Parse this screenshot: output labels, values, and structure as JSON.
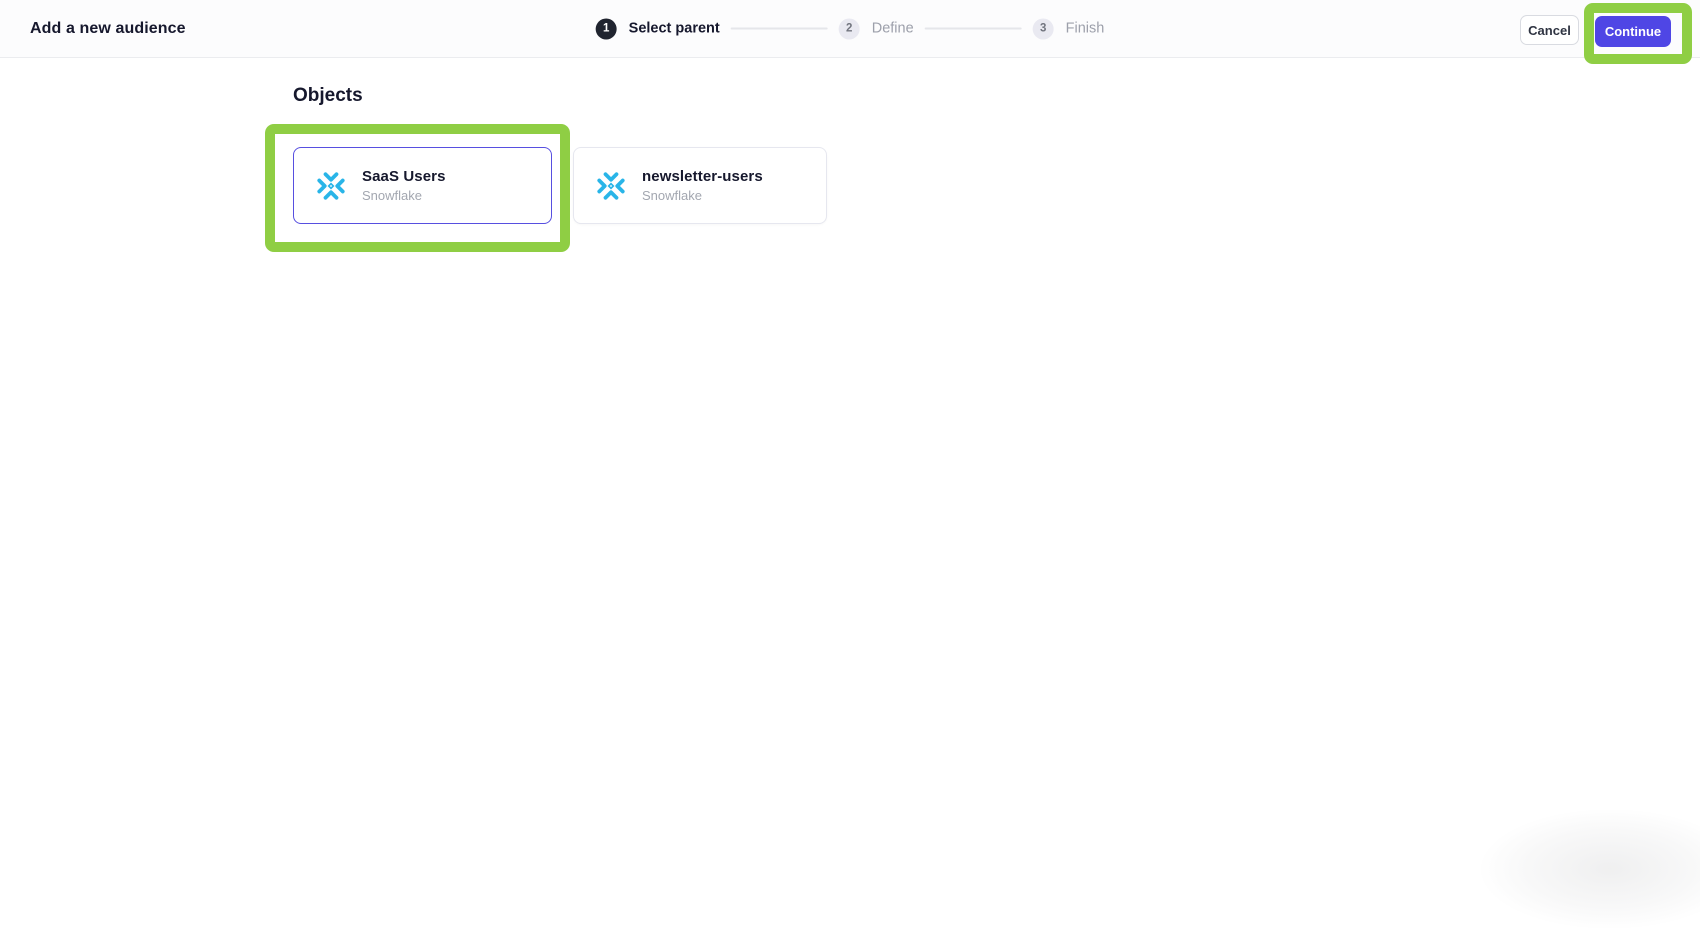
{
  "header": {
    "title": "Add a new audience",
    "steps": [
      {
        "number": "1",
        "label": "Select parent",
        "state": "active"
      },
      {
        "number": "2",
        "label": "Define",
        "state": "inactive"
      },
      {
        "number": "3",
        "label": "Finish",
        "state": "inactive"
      }
    ],
    "cancel_label": "Cancel",
    "continue_label": "Continue"
  },
  "main": {
    "section_title": "Objects",
    "objects": [
      {
        "name": "SaaS Users",
        "source": "Snowflake",
        "icon": "snowflake-icon",
        "selected": true
      },
      {
        "name": "newsletter-users",
        "source": "Snowflake",
        "icon": "snowflake-icon",
        "selected": false
      }
    ]
  },
  "annotations": {
    "highlight_color": "#8fce44",
    "highlighted_elements": [
      "selected-object-card",
      "continue-button"
    ]
  },
  "colors": {
    "accent": "#4f46e5",
    "snowflake_blue": "#29b5e8",
    "selected_card_border": "#574fe0",
    "active_step_circle": "#20242f"
  }
}
